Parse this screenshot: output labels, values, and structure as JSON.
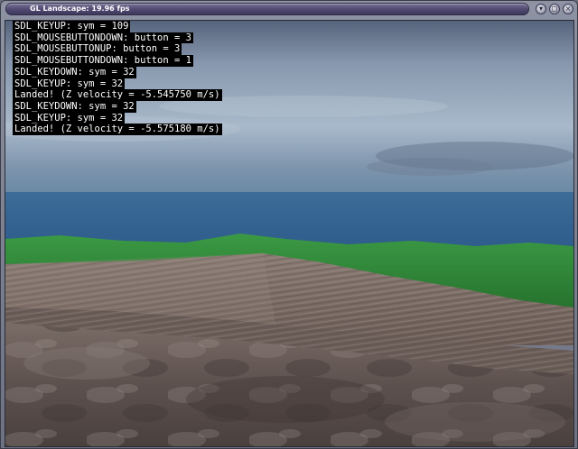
{
  "window": {
    "title": "GL Landscape: 19.96 fps",
    "minimize_icon": "minimize-icon",
    "maximize_icon": "maximize-icon",
    "close_icon": "close-icon"
  },
  "console": {
    "lines": [
      "SDL_KEYUP: sym = 109",
      "SDL_MOUSEBUTTONDOWN: button = 3",
      "SDL_MOUSEBUTTONUP: button = 3",
      "SDL_MOUSEBUTTONDOWN: button = 1",
      "SDL_KEYDOWN: sym = 32",
      "SDL_KEYUP: sym = 32",
      "Landed! (Z velocity = -5.545750 m/s)",
      "SDL_KEYDOWN: sym = 32",
      "SDL_KEYUP: sym = 32",
      "Landed! (Z velocity = -5.575180 m/s)"
    ]
  },
  "colors": {
    "sky_top": "#5d6b84",
    "sky_mid": "#9fb0c4",
    "sea": "#2f5a86",
    "grass": "#2f8a3a",
    "rock": "#6e5f58"
  }
}
